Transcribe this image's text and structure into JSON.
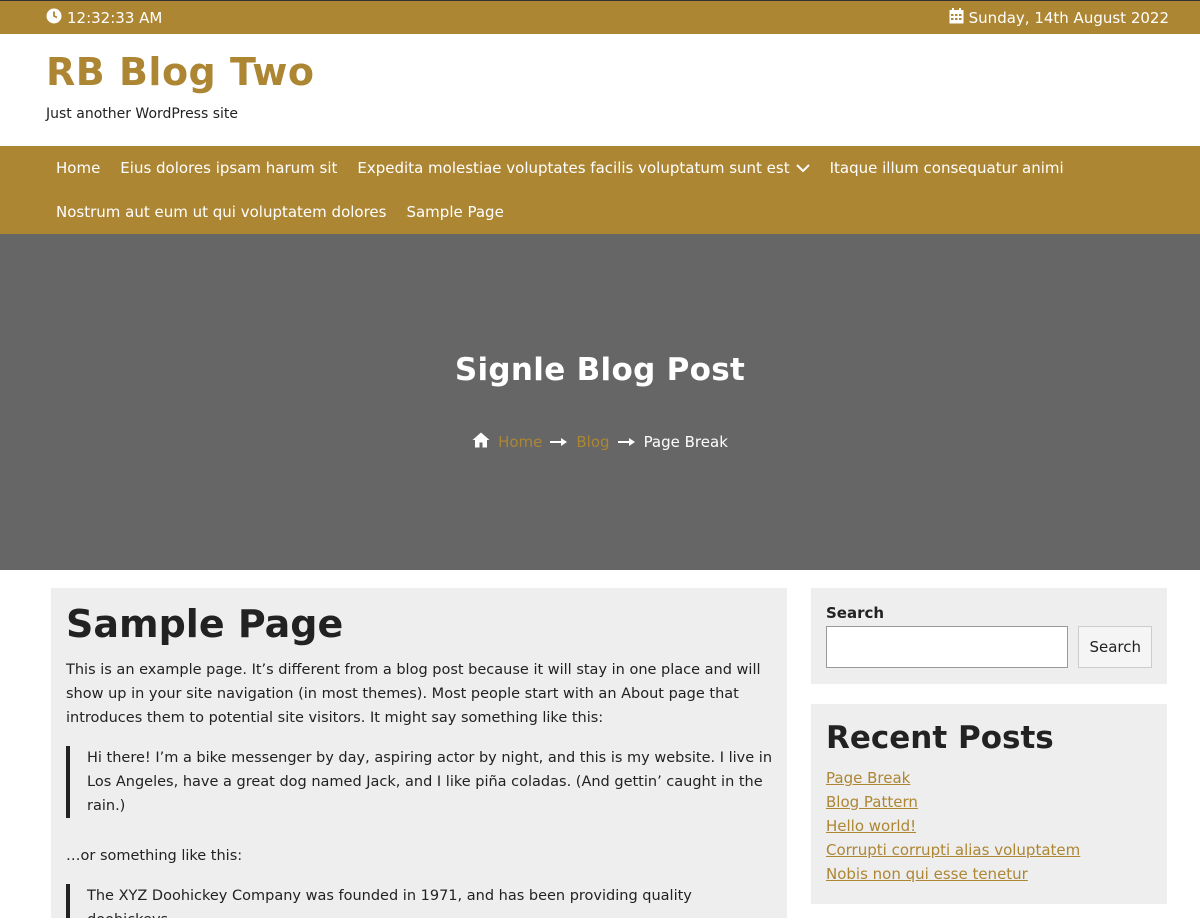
{
  "topbar": {
    "time": "12:32:33 AM",
    "date": "Sunday, 14th August 2022",
    "time_icon": "clock-icon",
    "date_icon": "calendar-icon"
  },
  "site": {
    "title": "RB Blog Two",
    "tagline": "Just another WordPress site"
  },
  "nav": {
    "items": [
      {
        "label": "Home"
      },
      {
        "label": "Eius dolores ipsam harum sit"
      },
      {
        "label": "Expedita molestiae voluptates facilis voluptatum sunt est"
      },
      {
        "label": "Itaque illum consequatur animi"
      },
      {
        "label": "Nostrum aut eum ut qui voluptatem dolores"
      },
      {
        "label": "Sample Page"
      }
    ]
  },
  "hero": {
    "title": "Signle Blog Post",
    "breadcrumb": {
      "home": "Home",
      "blog": "Blog",
      "current": "Page Break"
    }
  },
  "content": {
    "heading": "Sample Page",
    "intro": "This is an example page. It’s different from a blog post because it will stay in one place and will show up in your site navigation (in most themes). Most people start with an About page that introduces them to potential site visitors. It might say something like this:",
    "quote1": "Hi there! I’m a bike messenger by day, aspiring actor by night, and this is my website. I live in Los Angeles, have a great dog named Jack, and I like piña coladas. (And gettin’ caught in the rain.)",
    "middle": "…or something like this:",
    "quote2": "The XYZ Doohickey Company was founded in 1971, and has been providing quality doohickeys"
  },
  "sidebar": {
    "search": {
      "label": "Search",
      "button": "Search",
      "placeholder": ""
    },
    "recent": {
      "title": "Recent Posts",
      "posts": [
        "Page Break",
        "Blog Pattern",
        "Hello world!",
        "Corrupti corrupti alias voluptatem",
        "Nobis non qui esse tenetur"
      ]
    }
  },
  "colors": {
    "accent": "#ad8634",
    "hero_bg": "#666666",
    "panel_bg": "#eeeeee"
  }
}
